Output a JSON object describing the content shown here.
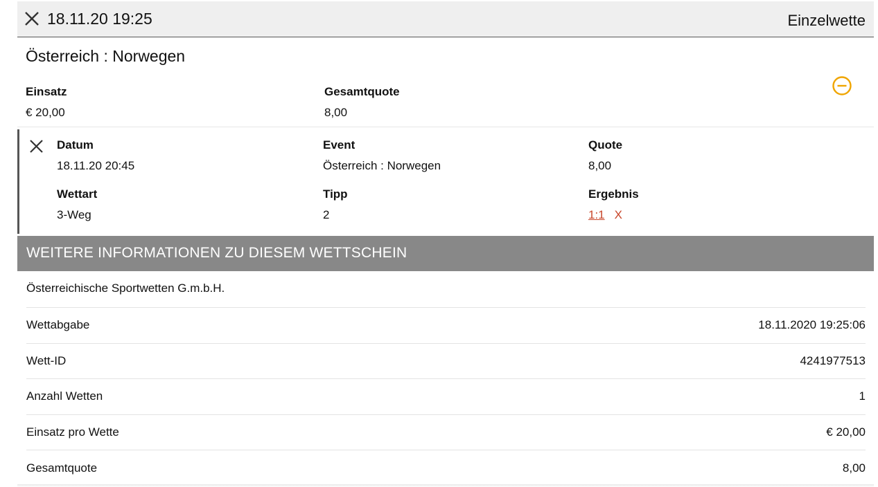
{
  "header": {
    "timestamp": "18.11.20 19:25",
    "bet_type": "Einzelwette"
  },
  "match_title": "Österreich : Norwegen",
  "summary": {
    "stake_label": "Einsatz",
    "stake_value": "€ 20,00",
    "total_odds_label": "Gesamtquote",
    "total_odds_value": "8,00"
  },
  "bet": {
    "date_label": "Datum",
    "date_value": "18.11.20 20:45",
    "event_label": "Event",
    "event_value": "Österreich : Norwegen",
    "odds_label": "Quote",
    "odds_value": "8,00",
    "bet_type_label": "Wettart",
    "bet_type_value": "3-Weg",
    "tip_label": "Tipp",
    "tip_value": "2",
    "result_label": "Ergebnis",
    "result_value": "1:1",
    "result_status": "X"
  },
  "info": {
    "title": "WEITERE INFORMATIONEN ZU DIESEM WETTSCHEIN",
    "company": "Österreichische Sportwetten G.m.b.H.",
    "rows": [
      {
        "label": "Wettabgabe",
        "value": "18.11.2020 19:25:06"
      },
      {
        "label": "Wett-ID",
        "value": "4241977513"
      },
      {
        "label": "Anzahl Wetten",
        "value": "1"
      },
      {
        "label": "Einsatz pro Wette",
        "value": "€ 20,00"
      },
      {
        "label": "Gesamtquote",
        "value": "8,00"
      }
    ]
  },
  "colors": {
    "accent_orange": "#f0a500",
    "result_red": "#c8462a",
    "info_bar_gray": "#888888"
  }
}
